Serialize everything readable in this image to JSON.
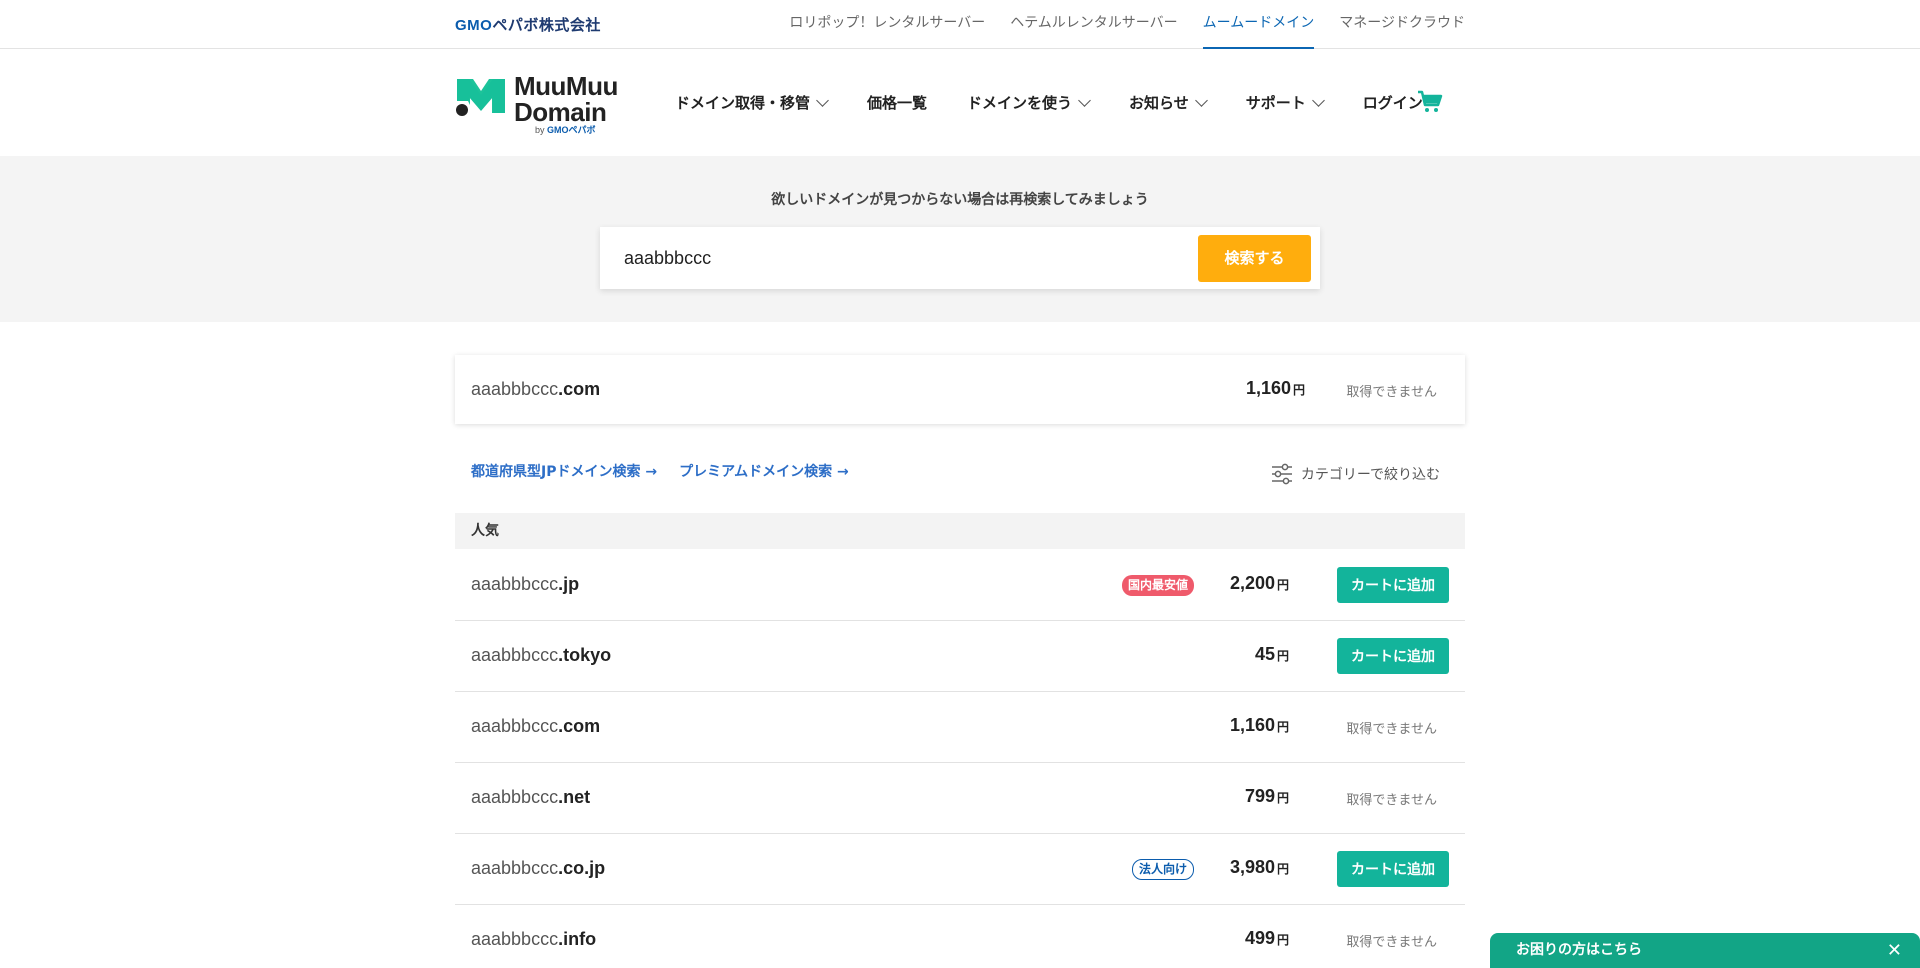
{
  "topbar": {
    "company_logo": "GMOペパボ株式会社",
    "company_logo_mark": "GMO",
    "company_logo_rest": "ペパボ株式会社",
    "links": [
      "ロリポップ！レンタルサーバー",
      "ヘテムルレンタルサーバー",
      "ムームードメイン",
      "マネージドクラウド"
    ],
    "active_index": 2
  },
  "header": {
    "logo_line1": "MuuMuu",
    "logo_line2": "Domain",
    "logo_by": "by",
    "logo_by_brand": "GMOペパボ",
    "nav": [
      {
        "label": "ドメイン取得・移管",
        "dropdown": true
      },
      {
        "label": "価格一覧",
        "dropdown": false
      },
      {
        "label": "ドメインを使う",
        "dropdown": true
      },
      {
        "label": "お知らせ",
        "dropdown": true
      },
      {
        "label": "サポート",
        "dropdown": true
      },
      {
        "label": "ログイン",
        "dropdown": false
      }
    ],
    "cart_icon": "cart-icon"
  },
  "search": {
    "hint": "欲しいドメインが見つからない場合は再検索してみましょう",
    "query": "aaabbbccc",
    "button": "検索する"
  },
  "top_result": {
    "name": "aaabbbccc",
    "tld": ".com",
    "price": "1,160",
    "currency": "円",
    "status": "取得できません"
  },
  "links": {
    "jp_pref": "都道府県型JPドメイン検索 →",
    "premium": "プレミアムドメイン検索 →",
    "filter": "カテゴリーで絞り込む"
  },
  "category": {
    "title": "人気"
  },
  "results": [
    {
      "name": "aaabbbccc",
      "tld": ".jp",
      "badge": "国内最安値",
      "badge_type": "red",
      "price": "2,200",
      "currency": "円",
      "action": "カートに追加",
      "available": true
    },
    {
      "name": "aaabbbccc",
      "tld": ".tokyo",
      "badge": "",
      "badge_type": "",
      "price": "45",
      "currency": "円",
      "action": "カートに追加",
      "available": true
    },
    {
      "name": "aaabbbccc",
      "tld": ".com",
      "badge": "",
      "badge_type": "",
      "price": "1,160",
      "currency": "円",
      "action": "取得できません",
      "available": false
    },
    {
      "name": "aaabbbccc",
      "tld": ".net",
      "badge": "",
      "badge_type": "",
      "price": "799",
      "currency": "円",
      "action": "取得できません",
      "available": false
    },
    {
      "name": "aaabbbccc",
      "tld": ".co.jp",
      "badge": "法人向け",
      "badge_type": "blue",
      "price": "3,980",
      "currency": "円",
      "action": "カートに追加",
      "available": true
    },
    {
      "name": "aaabbbccc",
      "tld": ".info",
      "badge": "",
      "badge_type": "",
      "price": "499",
      "currency": "円",
      "action": "取得できません",
      "available": false
    }
  ],
  "help": {
    "label": "お困りの方はこちら",
    "close": "✕"
  },
  "colors": {
    "accent_orange": "#ffad0d",
    "accent_green": "#13b49b",
    "link_blue": "#2d6ec7",
    "badge_red": "#ef5a6b"
  }
}
